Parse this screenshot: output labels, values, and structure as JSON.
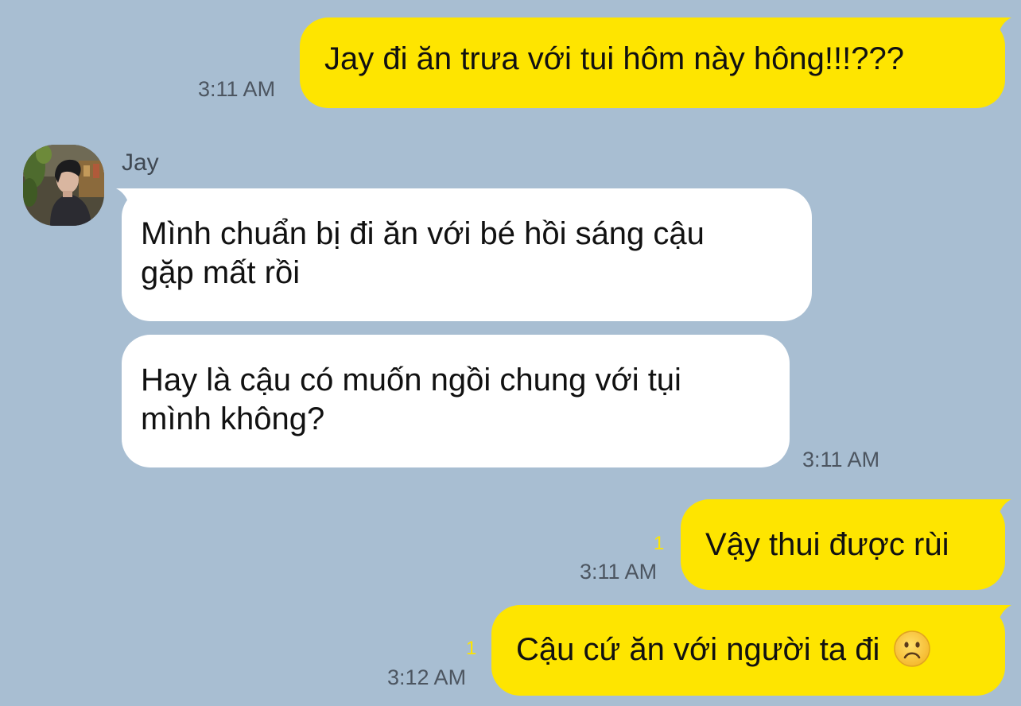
{
  "theme": {
    "background": "#a8bed2",
    "my_bubble": "#fee500",
    "their_bubble": "#ffffff",
    "read_count_color": "#fee500"
  },
  "contact": {
    "name": "Jay",
    "avatar_icon": "profile-photo-icon"
  },
  "messages": [
    {
      "sender": "me",
      "text": "Jay đi ăn trưa với tui hôm này hông!!!???",
      "time": "3:11 AM",
      "read_count": ""
    },
    {
      "sender": "Jay",
      "text_lines": [
        "Mình chuẩn bị đi ăn với bé hồi sáng cậu",
        "gặp mất rồi"
      ],
      "time": ""
    },
    {
      "sender": "Jay",
      "text_lines": [
        "Hay là cậu có muốn ngồi chung với tụi",
        "mình không?"
      ],
      "time": "3:11 AM"
    },
    {
      "sender": "me",
      "text": "Vậy thui được rùi",
      "time": "3:11 AM",
      "read_count": "1"
    },
    {
      "sender": "me",
      "text": "Cậu cứ ăn với người ta đi",
      "emoji": "frowning-face-emoji",
      "time": "3:12 AM",
      "read_count": "1"
    }
  ]
}
